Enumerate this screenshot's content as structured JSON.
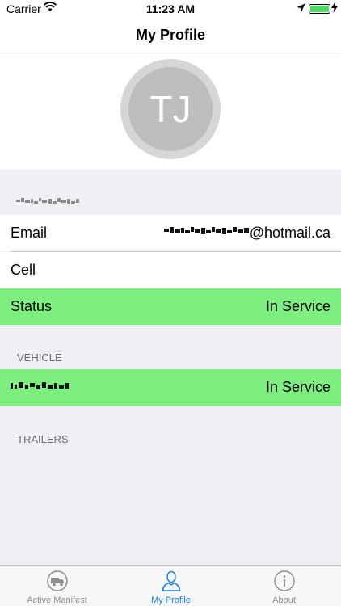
{
  "status_bar": {
    "carrier": "Carrier",
    "time": "11:23 AM",
    "icons": [
      "wifi-icon",
      "location-arrow-icon",
      "battery-icon",
      "charging-bolt-icon"
    ]
  },
  "nav": {
    "title": "My Profile"
  },
  "profile": {
    "initials": "TJ",
    "name": "",
    "email_domain": "@hotmail.ca"
  },
  "rows": {
    "email_label": "Email",
    "cell_label": "Cell",
    "cell_value": "",
    "status_label": "Status",
    "status_value": "In Service"
  },
  "vehicle": {
    "header": "VEHICLE",
    "name": "",
    "status": "In Service"
  },
  "trailers": {
    "header": "TRAILERS"
  },
  "tabs": [
    {
      "label": "Active Manifest",
      "icon": "truck-icon",
      "active": false
    },
    {
      "label": "My Profile",
      "icon": "person-icon",
      "active": true
    },
    {
      "label": "About",
      "icon": "info-icon",
      "active": false
    }
  ],
  "colors": {
    "in_service": "#7def7e",
    "tab_active": "#1a7ee6",
    "tab_inactive": "#8e8e93",
    "avatar": "#bdbdbd"
  }
}
